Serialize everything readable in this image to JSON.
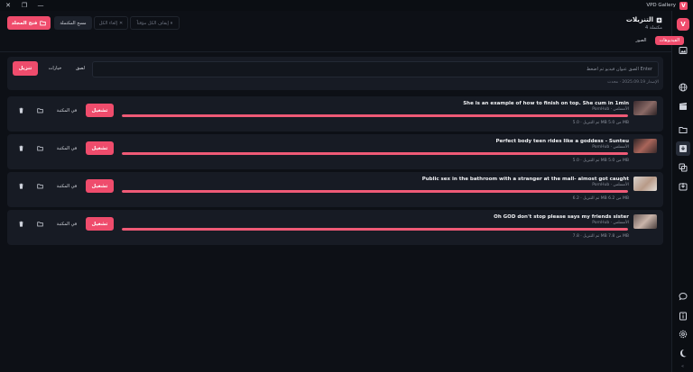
{
  "window": {
    "title": "VPD Gallery",
    "logo_letter": "V"
  },
  "sidebar": {
    "logo_letter": "V"
  },
  "header": {
    "title": "التنزيلات",
    "subtitle": "4 مكتملة",
    "open_folder_label": "فتح المجلد",
    "clear_completed_label": "مسح المكتملة",
    "cancel_all_label": "إلغاء الكل",
    "pause_all_label": "إيقاف الكل مؤقتاً"
  },
  "tabs": [
    {
      "label": "الفيديوهات",
      "active": true
    },
    {
      "label": "الصور",
      "active": false
    }
  ],
  "url_input": {
    "placeholder": "ألصق عنوان فيديو ثم اضغط Enter",
    "hint": "الإصدار 2025.09.19 · محدث",
    "download_label": "تنزيل",
    "options_label": "خيارات",
    "paste_label": "لصق"
  },
  "downloads": [
    {
      "title": "She is an example of how to finish on top. She cum in 1min",
      "source": "PornHub · الأمسلس",
      "status": "تم التنزيل · 5.0 MB من 5.0 MB",
      "progress": 1.0,
      "play_label": "تشغيل",
      "library_label": "في المكتبة"
    },
    {
      "title": "Perfect body teen rides like a goddess - Sunteu",
      "source": "PornHub · الأمسلس",
      "status": "تم التنزيل · 5.0 MB من 5.0 MB",
      "progress": 1.0,
      "play_label": "تشغيل",
      "library_label": "في المكتبة"
    },
    {
      "title": "Public sex in the bathroom with a stranger at the mall- almost got caught",
      "source": "PornHub · الأمسلس",
      "status": "تم التنزيل · 6.2 MB من 6.2 MB",
      "progress": 1.0,
      "play_label": "تشغيل",
      "library_label": "في المكتبة"
    },
    {
      "title": "Oh GOD don't stop please says my friends sister",
      "source": "PornHub · الأمسلس",
      "status": "تم التنزيل · 7.8 MB من 7.8 MB",
      "progress": 1.0,
      "play_label": "تشغيل",
      "library_label": "في المكتبة"
    }
  ],
  "colors": {
    "accent": "#ef4c6c",
    "panel": "#171b24",
    "background": "#0d1016"
  }
}
